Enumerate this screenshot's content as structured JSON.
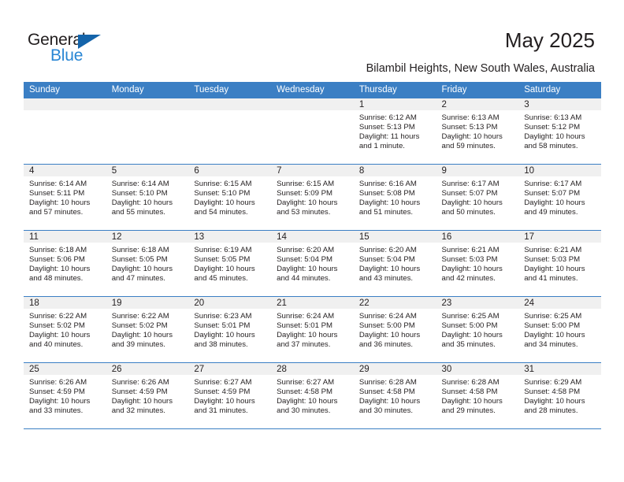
{
  "brand": {
    "name_part1": "General",
    "name_part2": "Blue",
    "accent_color": "#2986d4",
    "triangle_color": "#1464aa"
  },
  "header": {
    "title": "May 2025",
    "location": "Bilambil Heights, New South Wales, Australia"
  },
  "theme": {
    "header_row_bg": "#3b7fc4",
    "daynum_bg": "#f0f0f0",
    "row_border": "#3b7fc4"
  },
  "weekdays": [
    "Sunday",
    "Monday",
    "Tuesday",
    "Wednesday",
    "Thursday",
    "Friday",
    "Saturday"
  ],
  "labels": {
    "sunrise_prefix": "Sunrise:",
    "sunset_prefix": "Sunset:",
    "daylight_prefix": "Daylight:"
  },
  "weeks": [
    [
      {
        "day": ""
      },
      {
        "day": ""
      },
      {
        "day": ""
      },
      {
        "day": ""
      },
      {
        "day": "1",
        "sunrise": "Sunrise: 6:12 AM",
        "sunset": "Sunset: 5:13 PM",
        "daylight_line1": "Daylight: 11 hours",
        "daylight_line2": "and 1 minute."
      },
      {
        "day": "2",
        "sunrise": "Sunrise: 6:13 AM",
        "sunset": "Sunset: 5:13 PM",
        "daylight_line1": "Daylight: 10 hours",
        "daylight_line2": "and 59 minutes."
      },
      {
        "day": "3",
        "sunrise": "Sunrise: 6:13 AM",
        "sunset": "Sunset: 5:12 PM",
        "daylight_line1": "Daylight: 10 hours",
        "daylight_line2": "and 58 minutes."
      }
    ],
    [
      {
        "day": "4",
        "sunrise": "Sunrise: 6:14 AM",
        "sunset": "Sunset: 5:11 PM",
        "daylight_line1": "Daylight: 10 hours",
        "daylight_line2": "and 57 minutes."
      },
      {
        "day": "5",
        "sunrise": "Sunrise: 6:14 AM",
        "sunset": "Sunset: 5:10 PM",
        "daylight_line1": "Daylight: 10 hours",
        "daylight_line2": "and 55 minutes."
      },
      {
        "day": "6",
        "sunrise": "Sunrise: 6:15 AM",
        "sunset": "Sunset: 5:10 PM",
        "daylight_line1": "Daylight: 10 hours",
        "daylight_line2": "and 54 minutes."
      },
      {
        "day": "7",
        "sunrise": "Sunrise: 6:15 AM",
        "sunset": "Sunset: 5:09 PM",
        "daylight_line1": "Daylight: 10 hours",
        "daylight_line2": "and 53 minutes."
      },
      {
        "day": "8",
        "sunrise": "Sunrise: 6:16 AM",
        "sunset": "Sunset: 5:08 PM",
        "daylight_line1": "Daylight: 10 hours",
        "daylight_line2": "and 51 minutes."
      },
      {
        "day": "9",
        "sunrise": "Sunrise: 6:17 AM",
        "sunset": "Sunset: 5:07 PM",
        "daylight_line1": "Daylight: 10 hours",
        "daylight_line2": "and 50 minutes."
      },
      {
        "day": "10",
        "sunrise": "Sunrise: 6:17 AM",
        "sunset": "Sunset: 5:07 PM",
        "daylight_line1": "Daylight: 10 hours",
        "daylight_line2": "and 49 minutes."
      }
    ],
    [
      {
        "day": "11",
        "sunrise": "Sunrise: 6:18 AM",
        "sunset": "Sunset: 5:06 PM",
        "daylight_line1": "Daylight: 10 hours",
        "daylight_line2": "and 48 minutes."
      },
      {
        "day": "12",
        "sunrise": "Sunrise: 6:18 AM",
        "sunset": "Sunset: 5:05 PM",
        "daylight_line1": "Daylight: 10 hours",
        "daylight_line2": "and 47 minutes."
      },
      {
        "day": "13",
        "sunrise": "Sunrise: 6:19 AM",
        "sunset": "Sunset: 5:05 PM",
        "daylight_line1": "Daylight: 10 hours",
        "daylight_line2": "and 45 minutes."
      },
      {
        "day": "14",
        "sunrise": "Sunrise: 6:20 AM",
        "sunset": "Sunset: 5:04 PM",
        "daylight_line1": "Daylight: 10 hours",
        "daylight_line2": "and 44 minutes."
      },
      {
        "day": "15",
        "sunrise": "Sunrise: 6:20 AM",
        "sunset": "Sunset: 5:04 PM",
        "daylight_line1": "Daylight: 10 hours",
        "daylight_line2": "and 43 minutes."
      },
      {
        "day": "16",
        "sunrise": "Sunrise: 6:21 AM",
        "sunset": "Sunset: 5:03 PM",
        "daylight_line1": "Daylight: 10 hours",
        "daylight_line2": "and 42 minutes."
      },
      {
        "day": "17",
        "sunrise": "Sunrise: 6:21 AM",
        "sunset": "Sunset: 5:03 PM",
        "daylight_line1": "Daylight: 10 hours",
        "daylight_line2": "and 41 minutes."
      }
    ],
    [
      {
        "day": "18",
        "sunrise": "Sunrise: 6:22 AM",
        "sunset": "Sunset: 5:02 PM",
        "daylight_line1": "Daylight: 10 hours",
        "daylight_line2": "and 40 minutes."
      },
      {
        "day": "19",
        "sunrise": "Sunrise: 6:22 AM",
        "sunset": "Sunset: 5:02 PM",
        "daylight_line1": "Daylight: 10 hours",
        "daylight_line2": "and 39 minutes."
      },
      {
        "day": "20",
        "sunrise": "Sunrise: 6:23 AM",
        "sunset": "Sunset: 5:01 PM",
        "daylight_line1": "Daylight: 10 hours",
        "daylight_line2": "and 38 minutes."
      },
      {
        "day": "21",
        "sunrise": "Sunrise: 6:24 AM",
        "sunset": "Sunset: 5:01 PM",
        "daylight_line1": "Daylight: 10 hours",
        "daylight_line2": "and 37 minutes."
      },
      {
        "day": "22",
        "sunrise": "Sunrise: 6:24 AM",
        "sunset": "Sunset: 5:00 PM",
        "daylight_line1": "Daylight: 10 hours",
        "daylight_line2": "and 36 minutes."
      },
      {
        "day": "23",
        "sunrise": "Sunrise: 6:25 AM",
        "sunset": "Sunset: 5:00 PM",
        "daylight_line1": "Daylight: 10 hours",
        "daylight_line2": "and 35 minutes."
      },
      {
        "day": "24",
        "sunrise": "Sunrise: 6:25 AM",
        "sunset": "Sunset: 5:00 PM",
        "daylight_line1": "Daylight: 10 hours",
        "daylight_line2": "and 34 minutes."
      }
    ],
    [
      {
        "day": "25",
        "sunrise": "Sunrise: 6:26 AM",
        "sunset": "Sunset: 4:59 PM",
        "daylight_line1": "Daylight: 10 hours",
        "daylight_line2": "and 33 minutes."
      },
      {
        "day": "26",
        "sunrise": "Sunrise: 6:26 AM",
        "sunset": "Sunset: 4:59 PM",
        "daylight_line1": "Daylight: 10 hours",
        "daylight_line2": "and 32 minutes."
      },
      {
        "day": "27",
        "sunrise": "Sunrise: 6:27 AM",
        "sunset": "Sunset: 4:59 PM",
        "daylight_line1": "Daylight: 10 hours",
        "daylight_line2": "and 31 minutes."
      },
      {
        "day": "28",
        "sunrise": "Sunrise: 6:27 AM",
        "sunset": "Sunset: 4:58 PM",
        "daylight_line1": "Daylight: 10 hours",
        "daylight_line2": "and 30 minutes."
      },
      {
        "day": "29",
        "sunrise": "Sunrise: 6:28 AM",
        "sunset": "Sunset: 4:58 PM",
        "daylight_line1": "Daylight: 10 hours",
        "daylight_line2": "and 30 minutes."
      },
      {
        "day": "30",
        "sunrise": "Sunrise: 6:28 AM",
        "sunset": "Sunset: 4:58 PM",
        "daylight_line1": "Daylight: 10 hours",
        "daylight_line2": "and 29 minutes."
      },
      {
        "day": "31",
        "sunrise": "Sunrise: 6:29 AM",
        "sunset": "Sunset: 4:58 PM",
        "daylight_line1": "Daylight: 10 hours",
        "daylight_line2": "and 28 minutes."
      }
    ]
  ]
}
